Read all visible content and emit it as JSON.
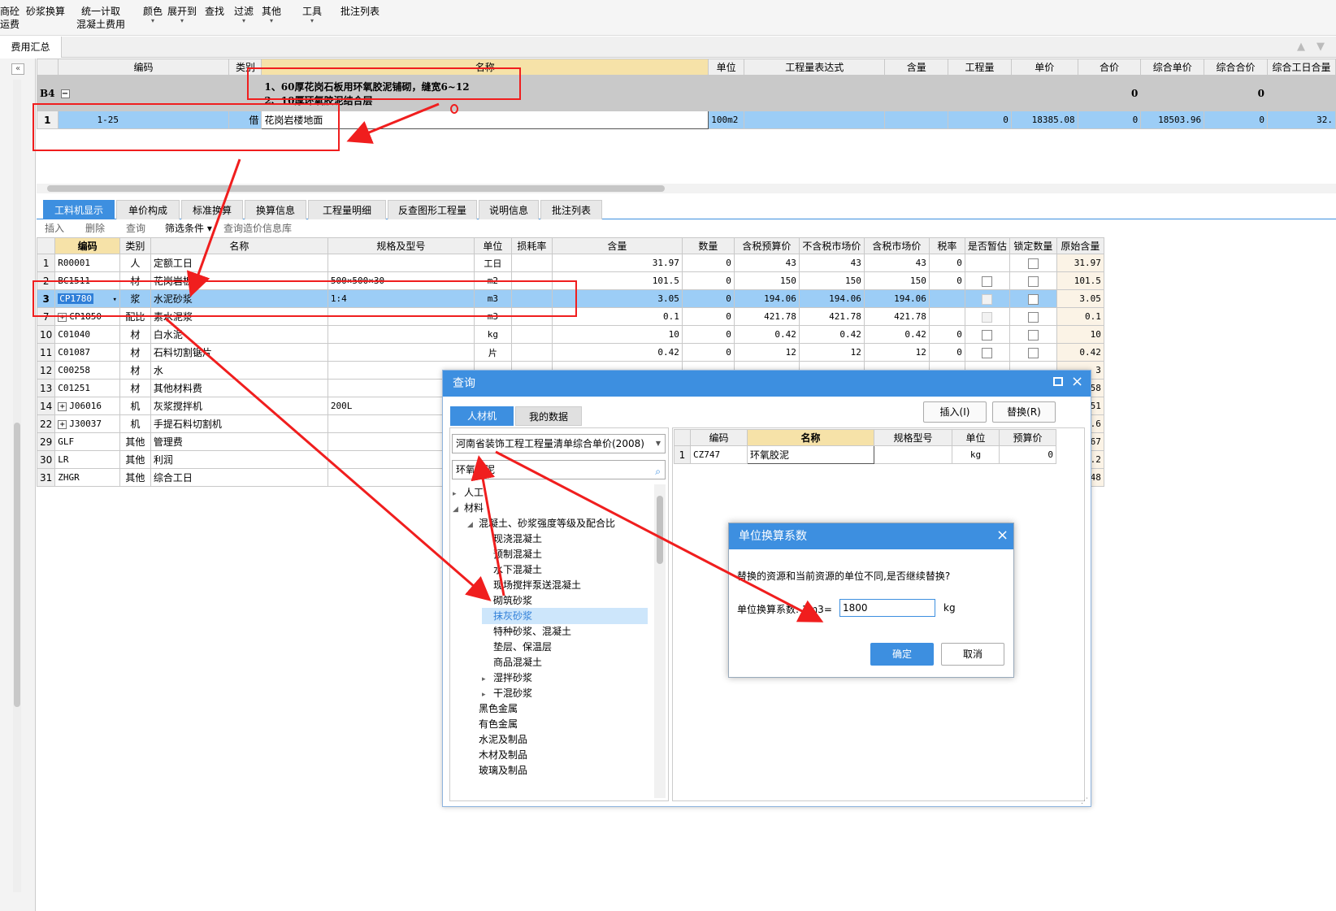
{
  "toolbar": {
    "items": [
      {
        "label": "商砼\n运费"
      },
      {
        "label": "砂浆换算"
      },
      {
        "label": "统一计取\n混凝土费用"
      },
      {
        "label": "颜色"
      },
      {
        "label": "展开到"
      },
      {
        "label": "查找"
      },
      {
        "label": "过滤"
      },
      {
        "label": "其他"
      },
      {
        "label": "工具"
      },
      {
        "label": "批注列表"
      }
    ]
  },
  "tabbar": {
    "fee_tab": "费用汇总"
  },
  "top_grid": {
    "headers": [
      "编码",
      "类别",
      "名称",
      "单位",
      "工程量表达式",
      "含量",
      "工程量",
      "单价",
      "合价",
      "综合单价",
      "综合合价",
      "综合工日合量"
    ],
    "group_row": {
      "label": "B4",
      "name_line1": "1、60厚花岗石板用环氧胶泥铺砌，缝宽6~12",
      "name_line2": "2、10厚环氧胶泥结合层",
      "hejia": "0",
      "zonghe_hejia": "0"
    },
    "item_row": {
      "rownum": "1",
      "code": "1-25",
      "type": "借",
      "name": "花岗岩楼地面",
      "unit": "100m2",
      "quantity": "0",
      "price": "18385.08",
      "total": "0",
      "comp_price": "18503.96",
      "comp_total": "0",
      "work": "32."
    }
  },
  "bottom_tabs": [
    "工料机显示",
    "单价构成",
    "标准换算",
    "换算信息",
    "工程量明细",
    "反查图形工程量",
    "说明信息",
    "批注列表"
  ],
  "bottom_subbar": [
    "插入",
    "删除",
    "查询",
    "筛选条件 ▾",
    "查询造价信息库"
  ],
  "bottom_grid": {
    "headers": [
      "编码",
      "类别",
      "名称",
      "规格及型号",
      "单位",
      "损耗率",
      "含量",
      "数量",
      "含税预算价",
      "不含税市场价",
      "含税市场价",
      "税率",
      "是否暂估",
      "锁定数量",
      "原始含量"
    ],
    "rows": [
      {
        "n": "1",
        "code": "R00001",
        "type": "人",
        "name": "定额工日",
        "spec": "",
        "unit": "工日",
        "content": "31.97",
        "qty": "0",
        "p1": "43",
        "p2": "43",
        "p3": "43",
        "tax": "0",
        "est": false,
        "lock": true,
        "orig": "31.97"
      },
      {
        "n": "2",
        "code": "BC1511",
        "type": "材",
        "name": "花岗岩板",
        "spec": "500×500×30",
        "unit": "m2",
        "content": "101.5",
        "qty": "0",
        "p1": "150",
        "p2": "150",
        "p3": "150",
        "tax": "0",
        "est": true,
        "lock": true,
        "orig": "101.5"
      },
      {
        "n": "3",
        "code": "CP1780",
        "type": "浆",
        "name": "水泥砂浆",
        "spec": "1:4",
        "unit": "m3",
        "content": "3.05",
        "qty": "0",
        "p1": "194.06",
        "p2": "194.06",
        "p3": "194.06",
        "tax": "",
        "est": true,
        "lock": true,
        "orig": "3.05"
      },
      {
        "n": "7",
        "code": "CP1850",
        "type": "配比",
        "name": "素水泥浆",
        "spec": "",
        "unit": "m3",
        "content": "0.1",
        "qty": "0",
        "p1": "421.78",
        "p2": "421.78",
        "p3": "421.78",
        "tax": "",
        "est": true,
        "lock": true,
        "orig": "0.1"
      },
      {
        "n": "10",
        "code": "C01040",
        "type": "材",
        "name": "白水泥",
        "spec": "",
        "unit": "kg",
        "content": "10",
        "qty": "0",
        "p1": "0.42",
        "p2": "0.42",
        "p3": "0.42",
        "tax": "0",
        "est": true,
        "lock": true,
        "orig": "10"
      },
      {
        "n": "11",
        "code": "C01087",
        "type": "材",
        "name": "石料切割锯片",
        "spec": "",
        "unit": "片",
        "content": "0.42",
        "qty": "0",
        "p1": "12",
        "p2": "12",
        "p3": "12",
        "tax": "0",
        "est": true,
        "lock": true,
        "orig": "0.42"
      },
      {
        "n": "12",
        "code": "C00258",
        "type": "材",
        "name": "水",
        "spec": "",
        "unit": "",
        "content": "",
        "qty": "",
        "p1": "",
        "p2": "",
        "p3": "",
        "tax": "",
        "est": false,
        "lock": false,
        "orig": "3"
      },
      {
        "n": "13",
        "code": "C01251",
        "type": "材",
        "name": "其他材料费",
        "spec": "",
        "unit": "",
        "content": "",
        "qty": "",
        "p1": "",
        "p2": "",
        "p3": "",
        "tax": "",
        "est": false,
        "lock": false,
        "orig": "45.58"
      },
      {
        "n": "14",
        "code": "J06016",
        "type": "机",
        "name": "灰浆搅拌机",
        "spec": "200L",
        "unit": "",
        "content": "",
        "qty": "",
        "p1": "",
        "p2": "",
        "p3": "",
        "tax": "",
        "est": false,
        "lock": false,
        "orig": "0.51"
      },
      {
        "n": "22",
        "code": "J30037",
        "type": "机",
        "name": "手提石料切割机",
        "spec": "",
        "unit": "",
        "content": "",
        "qty": "",
        "p1": "",
        "p2": "",
        "p3": "",
        "tax": "",
        "est": false,
        "lock": false,
        "orig": "1.6"
      },
      {
        "n": "29",
        "code": "GLF",
        "type": "其他",
        "name": "管理费",
        "spec": "",
        "unit": "",
        "content": "",
        "qty": "",
        "p1": "",
        "p2": "",
        "p3": "",
        "tax": "",
        "est": false,
        "lock": false,
        "orig": "32.67"
      },
      {
        "n": "30",
        "code": "LR",
        "type": "其他",
        "name": "利润",
        "spec": "",
        "unit": "",
        "content": "",
        "qty": "",
        "p1": "",
        "p2": "",
        "p3": "",
        "tax": "",
        "est": false,
        "lock": false,
        "orig": "487.2"
      },
      {
        "n": "31",
        "code": "ZHGR",
        "type": "其他",
        "name": "综合工日",
        "spec": "",
        "unit": "",
        "content": "",
        "qty": "",
        "p1": "",
        "p2": "",
        "p3": "",
        "tax": "",
        "est": false,
        "lock": false,
        "orig": "32.48"
      }
    ]
  },
  "query_dialog": {
    "title": "查询",
    "tab_active": "人材机",
    "tab_other": "我的数据",
    "insert_btn": "插入(I)",
    "replace_btn": "替换(R)",
    "library": "河南省装饰工程工程量清单综合单价(2008)",
    "search_value": "环氧胶泥",
    "tree": [
      {
        "label": "人工",
        "level": 0,
        "arrow": "▸"
      },
      {
        "label": "材料",
        "level": 0,
        "arrow": "◢"
      },
      {
        "label": "混凝土、砂浆强度等级及配合比",
        "level": 1,
        "arrow": "◢"
      },
      {
        "label": "现浇混凝土",
        "level": 2,
        "arrow": ""
      },
      {
        "label": "预制混凝土",
        "level": 2,
        "arrow": ""
      },
      {
        "label": "水下混凝土",
        "level": 2,
        "arrow": ""
      },
      {
        "label": "现场搅拌泵送混凝土",
        "level": 2,
        "arrow": ""
      },
      {
        "label": "砌筑砂浆",
        "level": 2,
        "arrow": ""
      },
      {
        "label": "抹灰砂浆",
        "level": 2,
        "arrow": "",
        "selected": true
      },
      {
        "label": "特种砂浆、混凝土",
        "level": 2,
        "arrow": ""
      },
      {
        "label": "垫层、保温层",
        "level": 2,
        "arrow": ""
      },
      {
        "label": "商品混凝土",
        "level": 2,
        "arrow": ""
      },
      {
        "label": "湿拌砂浆",
        "level": 2,
        "arrow": "▸"
      },
      {
        "label": "干混砂浆",
        "level": 2,
        "arrow": "▸"
      },
      {
        "label": "黑色金属",
        "level": 1,
        "arrow": ""
      },
      {
        "label": "有色金属",
        "level": 1,
        "arrow": ""
      },
      {
        "label": "水泥及制品",
        "level": 1,
        "arrow": ""
      },
      {
        "label": "木材及制品",
        "level": 1,
        "arrow": ""
      },
      {
        "label": "玻璃及制品",
        "level": 1,
        "arrow": ""
      }
    ],
    "result_headers": [
      "编码",
      "名称",
      "规格型号",
      "单位",
      "预算价"
    ],
    "result_row": {
      "n": "1",
      "code": "CZ747",
      "name": "环氧胶泥",
      "spec": "",
      "unit": "kg",
      "price": "0"
    }
  },
  "unit_dialog": {
    "title": "单位换算系数",
    "message": "替换的资源和当前资源的单位不同,是否继续替换?",
    "label": "单位换算系数: 1m3=",
    "value": "1800",
    "unit": "kg",
    "ok": "确定",
    "cancel": "取消"
  },
  "colors": {
    "accent": "#3d8fe0",
    "highlight_row": "#9ccdf6",
    "annotation": "#f01e1e"
  }
}
